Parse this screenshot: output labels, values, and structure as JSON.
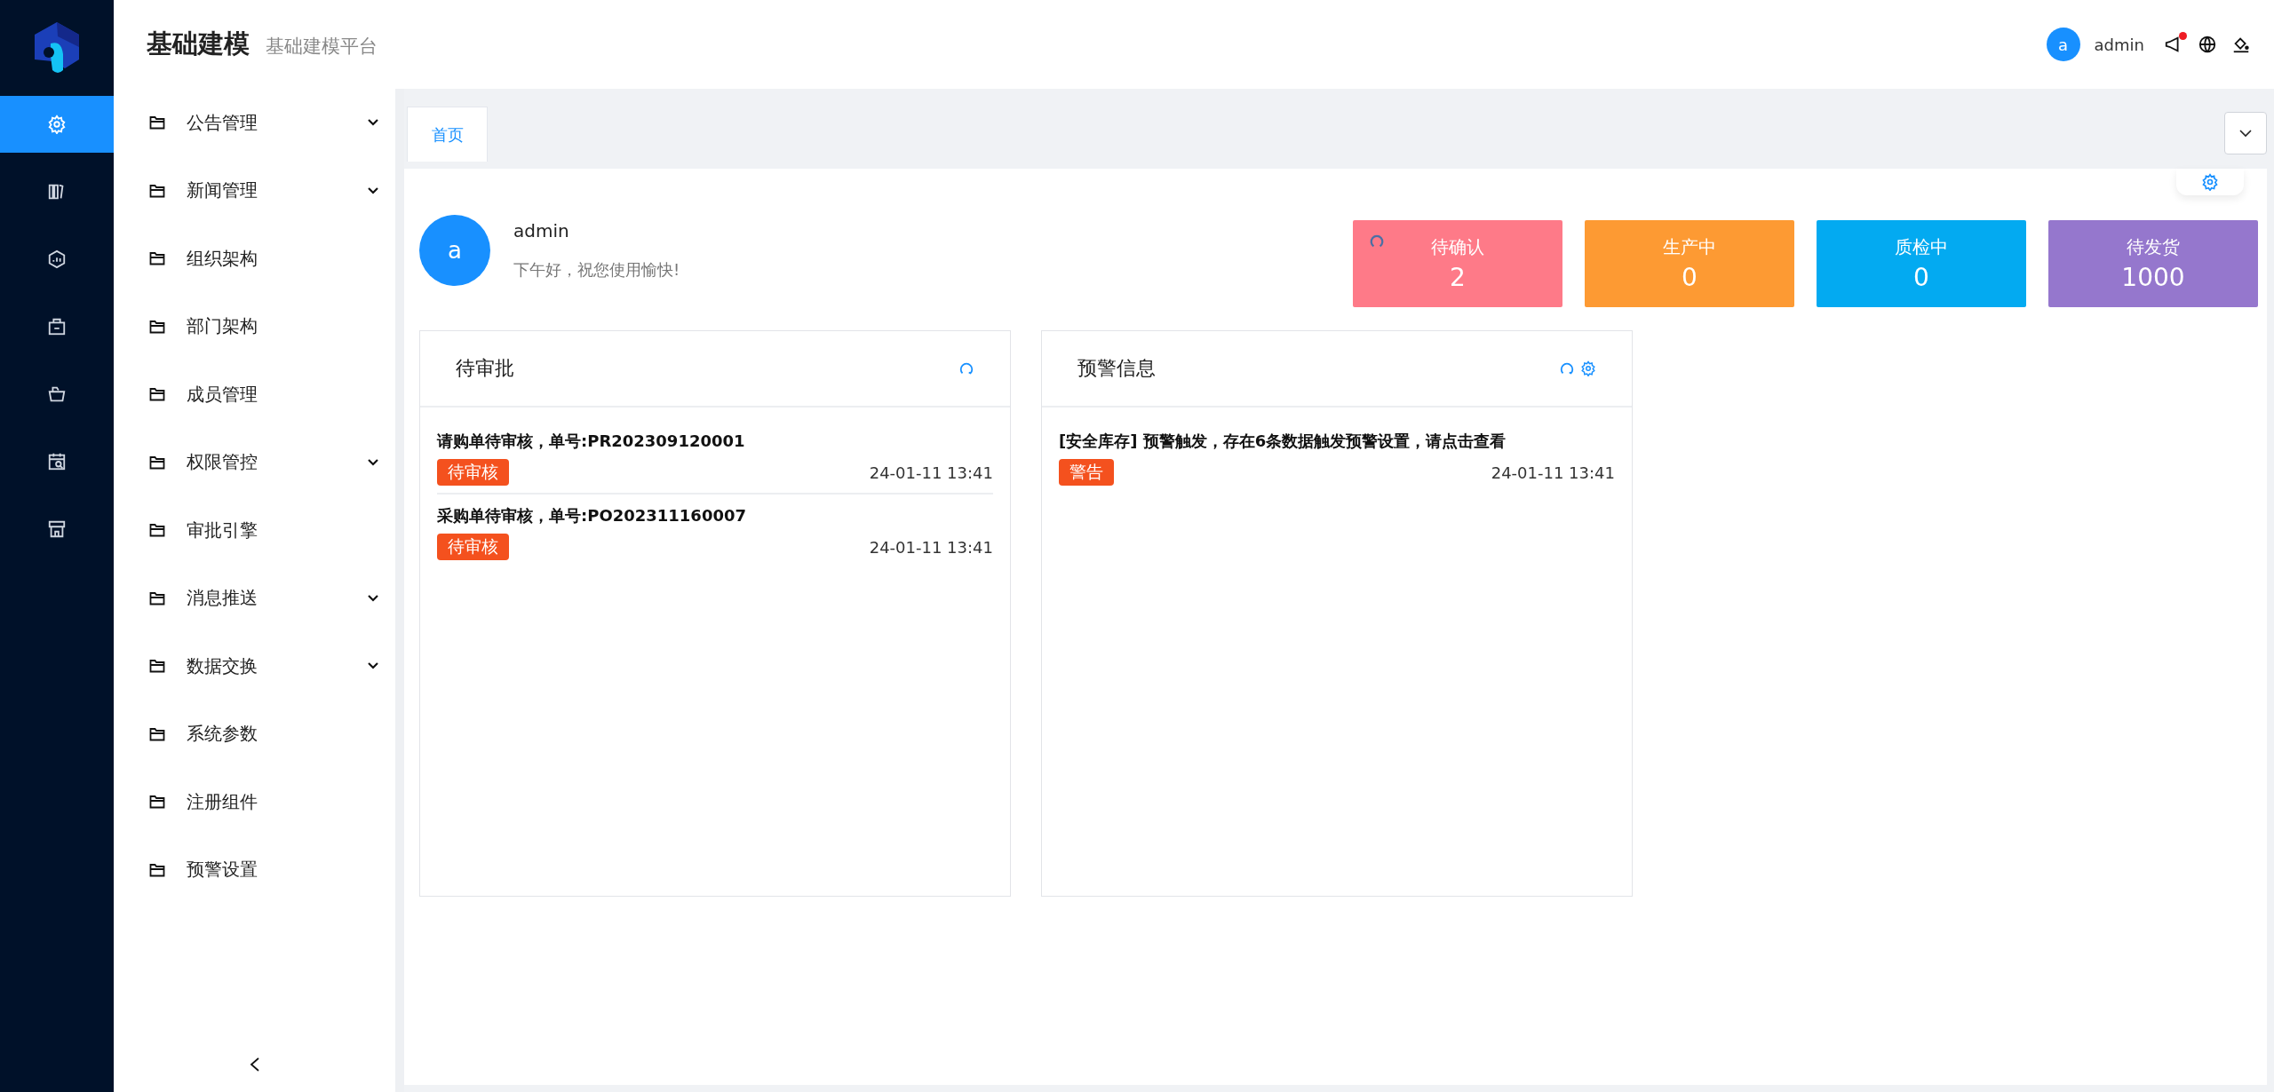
{
  "app": {
    "title": "基础建模",
    "subtitle": "基础建模平台"
  },
  "rail": [
    {
      "selected": true
    },
    {
      "selected": false
    },
    {
      "selected": false
    },
    {
      "selected": false
    },
    {
      "selected": false
    },
    {
      "selected": false
    },
    {
      "selected": false
    }
  ],
  "header": {
    "avatar": "a",
    "user": "admin",
    "unread": true
  },
  "menu": [
    {
      "label": "公告管理",
      "kind": "group"
    },
    {
      "label": "新闻管理",
      "kind": "group"
    },
    {
      "label": "组织架构",
      "kind": "link"
    },
    {
      "label": "部门架构",
      "kind": "link"
    },
    {
      "label": "成员管理",
      "kind": "link"
    },
    {
      "label": "权限管控",
      "kind": "group"
    },
    {
      "label": "审批引擎",
      "kind": "link"
    },
    {
      "label": "消息推送",
      "kind": "group"
    },
    {
      "label": "数据交换",
      "kind": "group"
    },
    {
      "label": "系统参数",
      "kind": "link"
    },
    {
      "label": "注册组件",
      "kind": "link"
    },
    {
      "label": "预警设置",
      "kind": "link"
    }
  ],
  "tabs": [
    {
      "label": "首页",
      "selected": true
    }
  ],
  "welcome": {
    "avatar": "a",
    "name": "admin",
    "greeting": "下午好，祝您使用愉快!"
  },
  "stats": [
    {
      "label": "待确认",
      "value": "2",
      "color": "#fe7a88",
      "loading": true
    },
    {
      "label": "生产中",
      "value": "0",
      "color": "#fd9a33",
      "loading": false
    },
    {
      "label": "质检中",
      "value": "0",
      "color": "#03aaf1",
      "loading": false
    },
    {
      "label": "待发货",
      "value": "1000",
      "color": "#9577cd",
      "loading": false
    }
  ],
  "panels": [
    {
      "title": "待审批",
      "tools": [
        {
          "kind": "refresh"
        }
      ],
      "items": [
        {
          "text": "请购单待审核，单号:PR202309120001",
          "tag": "待审核",
          "time": "24-01-11 13:41"
        },
        {
          "text": "采购单待审核，单号:PO202311160007",
          "tag": "待审核",
          "time": "24-01-11 13:41"
        }
      ]
    },
    {
      "title": "预警信息",
      "tools": [
        {
          "kind": "refresh"
        },
        {
          "kind": "settings"
        }
      ],
      "items": [
        {
          "text": "[安全库存] 预警触发，存在6条数据触发预警设置，请点击查看",
          "tag": "警告",
          "time": "24-01-11 13:41"
        }
      ]
    }
  ]
}
